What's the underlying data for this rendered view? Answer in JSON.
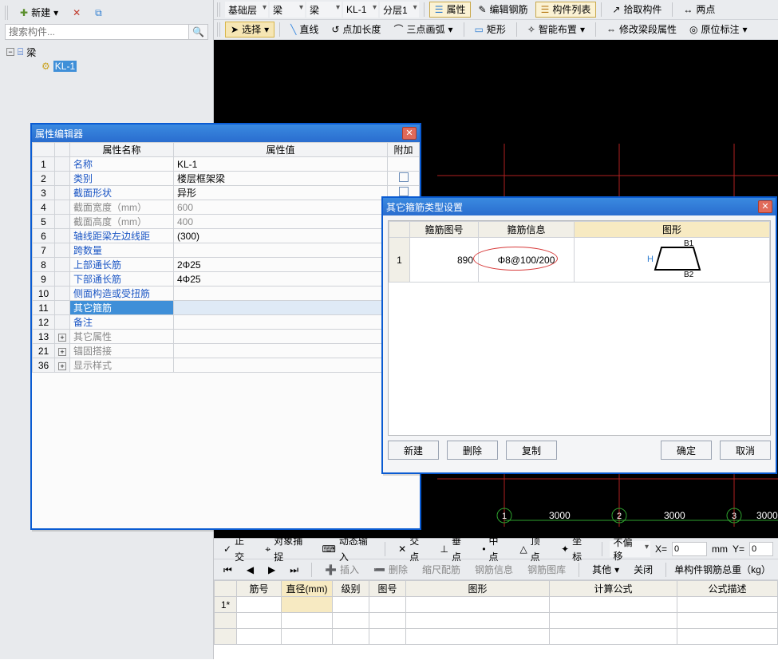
{
  "toolbar_top": {
    "new": "新建",
    "floor": "基础层",
    "cat1": "梁",
    "cat2": "梁",
    "member": "KL-1",
    "layer": "分层1",
    "props_btn": "属性",
    "edit_rebar": "编辑钢筋",
    "member_list": "构件列表",
    "pick_member": "拾取构件",
    "two_point": "两点"
  },
  "toolbar_draw": {
    "select": "选择",
    "line": "直线",
    "arc_len": "点加长度",
    "three_arc": "三点画弧",
    "rect": "矩形",
    "smart_layout": "智能布置",
    "edit_span": "修改梁段属性",
    "origin_label": "原位标注"
  },
  "search": {
    "placeholder": "搜索构件..."
  },
  "tree": {
    "root": "梁",
    "child": "KL-1"
  },
  "prop_editor": {
    "title": "属性编辑器",
    "col_name": "属性名称",
    "col_value": "属性值",
    "col_add": "附加",
    "rows": [
      {
        "idx": "1",
        "name": "名称",
        "value": "KL-1",
        "link": true
      },
      {
        "idx": "2",
        "name": "类别",
        "value": "楼层框架梁",
        "link": true,
        "chk": true
      },
      {
        "idx": "3",
        "name": "截面形状",
        "value": "异形",
        "link": true,
        "chk": true
      },
      {
        "idx": "4",
        "name": "截面宽度（mm）",
        "value": "600",
        "gray": true
      },
      {
        "idx": "5",
        "name": "截面高度（mm）",
        "value": "400",
        "gray": true
      },
      {
        "idx": "6",
        "name": "轴线距梁左边线距",
        "value": "(300)",
        "link": true
      },
      {
        "idx": "7",
        "name": "跨数量",
        "value": "",
        "link": true
      },
      {
        "idx": "8",
        "name": "上部通长筋",
        "value": "2Φ25",
        "link": true
      },
      {
        "idx": "9",
        "name": "下部通长筋",
        "value": "4Φ25",
        "link": true
      },
      {
        "idx": "10",
        "name": "侧面构造或受扭筋",
        "value": "",
        "link": true
      },
      {
        "idx": "11",
        "name": "其它箍筋",
        "value": "",
        "sel": true
      },
      {
        "idx": "12",
        "name": "备注",
        "value": "",
        "link": true
      },
      {
        "idx": "13",
        "name": "其它属性",
        "value": "",
        "gray": true,
        "exp": true
      },
      {
        "idx": "21",
        "name": "锚固搭接",
        "value": "",
        "gray": true,
        "exp": true
      },
      {
        "idx": "36",
        "name": "显示样式",
        "value": "",
        "gray": true,
        "exp": true
      }
    ]
  },
  "stirrup": {
    "title": "其它箍筋类型设置",
    "col_id": "箍筋图号",
    "col_info": "箍筋信息",
    "col_shape": "图形",
    "row1_num": "890",
    "row1_info": "Φ8@100/200",
    "shape_b1": "B1",
    "shape_b2": "B2",
    "shape_h": "H",
    "btn_new": "新建",
    "btn_del": "删除",
    "btn_copy": "复制",
    "btn_ok": "确定",
    "btn_cancel": "取消"
  },
  "bottom1": {
    "orth": "正交",
    "snap": "对象捕捉",
    "dyn": "动态输入",
    "cross": "交点",
    "perp": "垂点",
    "mid": "中点",
    "vertex": "顶点",
    "coord": "坐标",
    "nooffset": "不偏移",
    "x_lbl": "X=",
    "y_lbl": "Y=",
    "unit": "mm",
    "x_val": "0",
    "y_val": "0"
  },
  "bottom2": {
    "insert": "插入",
    "delete": "删除",
    "scale": "缩尺配筋",
    "rebar_info": "钢筋信息",
    "rebar_lib": "钢筋图库",
    "other": "其他",
    "close": "关闭",
    "weight_label": "单构件钢筋总重（kg）"
  },
  "sheet": {
    "cols": [
      "筋号",
      "直径(mm)",
      "级别",
      "图号",
      "图形",
      "计算公式",
      "公式描述"
    ],
    "row1_num": "1*"
  },
  "axis": {
    "span1": "3000",
    "span2": "3000",
    "span3": "3000",
    "m1": "1",
    "m2": "2",
    "m3": "3"
  }
}
